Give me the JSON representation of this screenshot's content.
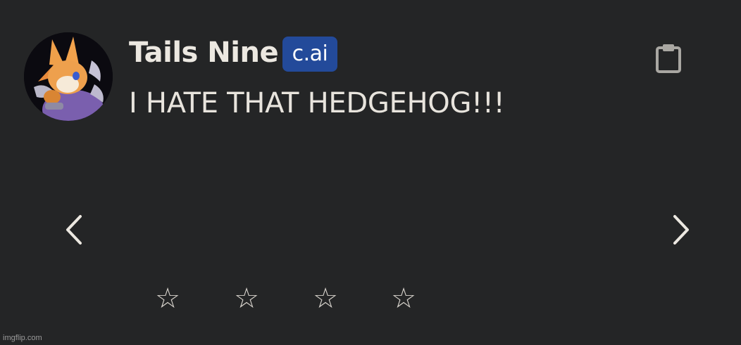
{
  "message": {
    "author_name": "Tails Nine",
    "badge_label": "c.ai",
    "text": "I HATE THAT HEDGEHOG!!!",
    "avatar_icon": "character-avatar",
    "copy_icon": "clipboard-icon"
  },
  "navigation": {
    "prev_icon": "chevron-left-icon",
    "next_icon": "chevron-right-icon"
  },
  "rating": {
    "stars": [
      {
        "glyph": "☆"
      },
      {
        "glyph": "☆"
      },
      {
        "glyph": "☆"
      },
      {
        "glyph": "☆"
      }
    ],
    "max": 4,
    "value": 0
  },
  "watermark": "imgflip.com",
  "colors": {
    "background": "#242526",
    "badge": "#234a9a",
    "text": "#e8e4dd"
  }
}
